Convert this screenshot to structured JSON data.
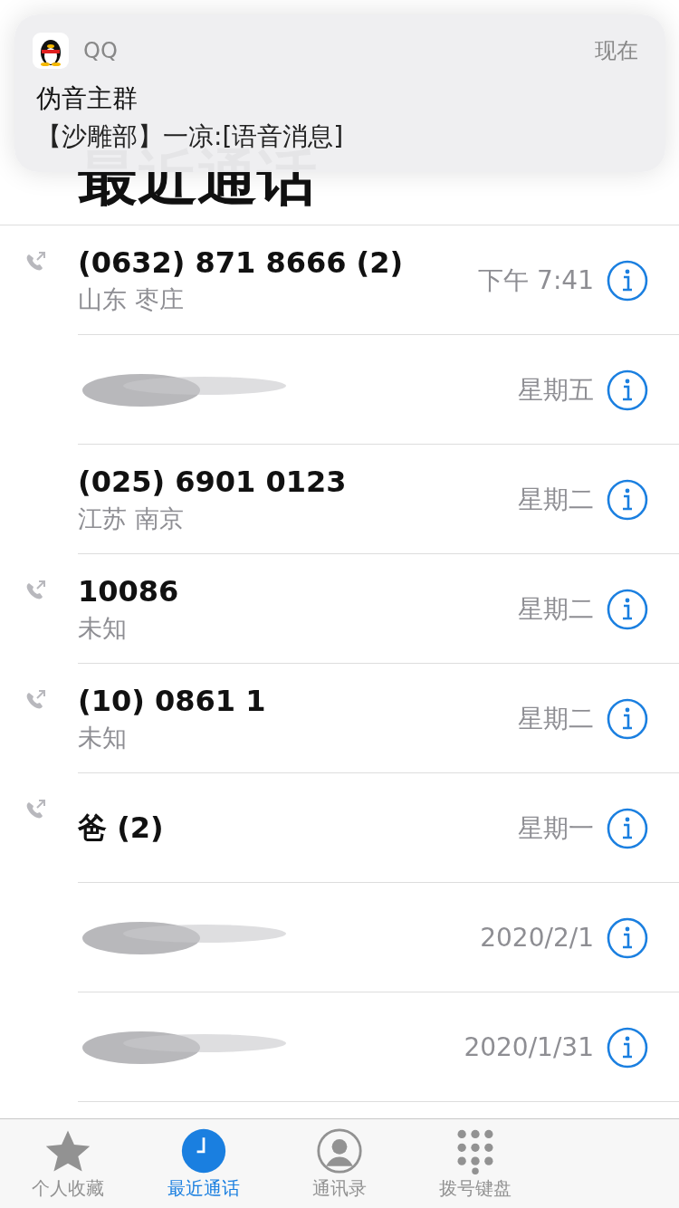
{
  "notification": {
    "app": "QQ",
    "time": "现在",
    "title": "伪音主群",
    "body": "【沙雕部】一凉:[语音消息]"
  },
  "title": "最近通话",
  "calls": [
    {
      "kind": "call",
      "outgoing": true,
      "name": "(0632) 871 8666 (2)",
      "subtitle": "山东 枣庄",
      "time": "下午 7:41"
    },
    {
      "kind": "redacted",
      "outgoing": false,
      "time": "星期五"
    },
    {
      "kind": "call",
      "outgoing": false,
      "name": "(025) 6901 0123",
      "subtitle": "江苏 南京",
      "time": "星期二"
    },
    {
      "kind": "call",
      "outgoing": true,
      "name": "10086",
      "subtitle": "未知",
      "time": "星期二"
    },
    {
      "kind": "call",
      "outgoing": true,
      "name": "(10) 0861 1",
      "subtitle": "未知",
      "time": "星期二"
    },
    {
      "kind": "call",
      "outgoing": true,
      "name": "爸 (2)",
      "time": "星期一"
    },
    {
      "kind": "redacted",
      "outgoing": false,
      "time": "2020/2/1"
    },
    {
      "kind": "redacted",
      "outgoing": false,
      "time": "2020/1/31"
    }
  ],
  "tabs": [
    {
      "label": "个人收藏",
      "selected": false
    },
    {
      "label": "最近通话",
      "selected": true
    },
    {
      "label": "通讯录",
      "selected": false
    },
    {
      "label": "拨号键盘",
      "selected": false
    }
  ]
}
